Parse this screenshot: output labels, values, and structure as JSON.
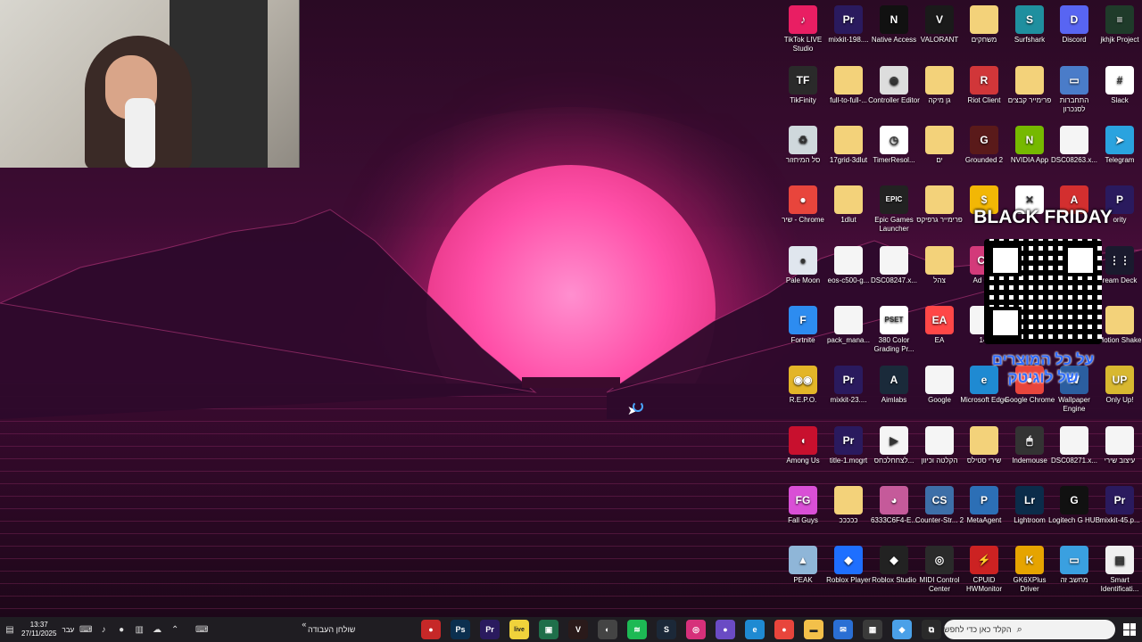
{
  "desktop_icons": [
    {
      "label": "TikTok LIVE Studio",
      "icon": "tiktok-icon",
      "color": "#e91e63",
      "glyph": "♪"
    },
    {
      "label": "mixkit-198....",
      "icon": "premiere-icon",
      "color": "#2a1a5e",
      "glyph": "Pr"
    },
    {
      "label": "Native Access",
      "icon": "native-access-icon",
      "color": "#111111",
      "glyph": "N"
    },
    {
      "label": "VALORANT",
      "icon": "valorant-icon",
      "color": "#1a1a1a",
      "glyph": "V"
    },
    {
      "label": "משחקים",
      "icon": "folder-icon",
      "color": "#f3d27a",
      "glyph": ""
    },
    {
      "label": "Surfshark",
      "icon": "surfshark-icon",
      "color": "#1f8f9f",
      "glyph": "S"
    },
    {
      "label": "Discord",
      "icon": "discord-icon",
      "color": "#5865f2",
      "glyph": "D"
    },
    {
      "label": "jkhjk Project",
      "icon": "project-icon",
      "color": "#1f3b2a",
      "glyph": "≡"
    },
    {
      "label": "TikFinity",
      "icon": "tikfinity-icon",
      "color": "#2a2a2a",
      "glyph": "TF"
    },
    {
      "label": "full-to-full-...",
      "icon": "folder-icon",
      "color": "#f3d27a",
      "glyph": ""
    },
    {
      "label": "Controller Editor",
      "icon": "controller-icon",
      "color": "#dddddd",
      "glyph": "◉"
    },
    {
      "label": "גן מיקה",
      "icon": "folder-icon",
      "color": "#f3d27a",
      "glyph": ""
    },
    {
      "label": "Riot Client",
      "icon": "riot-icon",
      "color": "#d13639",
      "glyph": "R"
    },
    {
      "label": "פרימייר קבצים",
      "icon": "folder-icon",
      "color": "#f3d27a",
      "glyph": ""
    },
    {
      "label": "התחברות לסנכרון",
      "icon": "pc-icon",
      "color": "#4a7cc9",
      "glyph": "▭"
    },
    {
      "label": "Slack",
      "icon": "slack-icon",
      "color": "#ffffff",
      "glyph": "#"
    },
    {
      "label": "סל המיחזור",
      "icon": "recycle-bin-icon",
      "color": "#cfd8dc",
      "glyph": "♻"
    },
    {
      "label": "17grid-3dlut",
      "icon": "folder-icon",
      "color": "#f3d27a",
      "glyph": ""
    },
    {
      "label": "TimerResol...",
      "icon": "timer-icon",
      "color": "#ffffff",
      "glyph": "◷"
    },
    {
      "label": "ים",
      "icon": "folder-icon",
      "color": "#f3d27a",
      "glyph": ""
    },
    {
      "label": "Grounded 2",
      "icon": "grounded-icon",
      "color": "#5a1a1a",
      "glyph": "G"
    },
    {
      "label": "NVIDIA App",
      "icon": "nvidia-icon",
      "color": "#76b900",
      "glyph": "N"
    },
    {
      "label": "DSC08263.x...",
      "icon": "file-icon",
      "color": "#f5f5f5",
      "glyph": ""
    },
    {
      "label": "Telegram",
      "icon": "telegram-icon",
      "color": "#2aa3df",
      "glyph": "➤"
    },
    {
      "label": "שיר - Chrome",
      "icon": "chrome-icon",
      "color": "#e8453c",
      "glyph": "●"
    },
    {
      "label": "1dlut",
      "icon": "folder-icon",
      "color": "#f3d27a",
      "glyph": ""
    },
    {
      "label": "Epic Games Launcher",
      "icon": "epic-games-icon",
      "color": "#222222",
      "glyph": "EPIC"
    },
    {
      "label": "פרימייר גרפיקס",
      "icon": "folder-icon",
      "color": "#f3d27a",
      "glyph": ""
    },
    {
      "label": "",
      "icon": "coin-icon",
      "color": "#f2b705",
      "glyph": "$"
    },
    {
      "label": "",
      "icon": "capcut-icon",
      "color": "#ffffff",
      "glyph": "✕"
    },
    {
      "label": "",
      "icon": "acrobat-icon",
      "color": "#d32f2f",
      "glyph": "A"
    },
    {
      "label": "ority",
      "icon": "premiere-icon",
      "color": "#2a1a5e",
      "glyph": "P"
    },
    {
      "label": "Pale Moon",
      "icon": "pale-moon-icon",
      "color": "#e0e6ee",
      "glyph": "●"
    },
    {
      "label": "eos-c500-g...",
      "icon": "file-icon",
      "color": "#f5f5f5",
      "glyph": ""
    },
    {
      "label": "DSC08247.x...",
      "icon": "file-icon",
      "color": "#f5f5f5",
      "glyph": ""
    },
    {
      "label": "צהל",
      "icon": "folder-icon",
      "color": "#f3d27a",
      "glyph": ""
    },
    {
      "label": "Ad Cre",
      "icon": "adobe-cc-icon",
      "color": "#d33a7a",
      "glyph": "Cc"
    },
    {
      "label": "ream Deck",
      "icon": "stream-deck-icon",
      "color": "#1a1a2e",
      "glyph": "⋮⋮"
    },
    {
      "label": "Fortnite",
      "icon": "fortnite-icon",
      "color": "#2d8cf0",
      "glyph": "F"
    },
    {
      "label": "pack_mana...",
      "icon": "file-icon",
      "color": "#f5f5f5",
      "glyph": ""
    },
    {
      "label": "380 Color Grading Pr...",
      "icon": "pset-icon",
      "color": "#ffffff",
      "glyph": "PSET"
    },
    {
      "label": "EA",
      "icon": "ea-icon",
      "color": "#ff4747",
      "glyph": "EA"
    },
    {
      "label": "14.",
      "icon": "file-icon",
      "color": "#f5f5f5",
      "glyph": ""
    },
    {
      "label": "Motion Shake",
      "icon": "folder-icon",
      "color": "#f3d27a",
      "glyph": ""
    },
    {
      "label": "R.E.P.O.",
      "icon": "repo-icon",
      "color": "#e3b528",
      "glyph": "◉◉"
    },
    {
      "label": "mixkit-23....",
      "icon": "premiere-icon",
      "color": "#2a1a5e",
      "glyph": "Pr"
    },
    {
      "label": "Aimlabs",
      "icon": "aimlabs-icon",
      "color": "#1a2a3a",
      "glyph": "A"
    },
    {
      "label": "Google",
      "icon": "file-icon",
      "color": "#f5f5f5",
      "glyph": ""
    },
    {
      "label": "Microsoft Edge",
      "icon": "edge-icon",
      "color": "#1f8ad2",
      "glyph": "e"
    },
    {
      "label": "Google Chrome",
      "icon": "chrome-icon",
      "color": "#e8453c",
      "glyph": "●"
    },
    {
      "label": "Wallpaper Engine",
      "icon": "wallpaper-engine-icon",
      "color": "#2b5ea0",
      "glyph": "W"
    },
    {
      "label": "Only Up!",
      "icon": "only-up-icon",
      "color": "#d8b830",
      "glyph": "UP"
    },
    {
      "label": "Among Us",
      "icon": "among-us-icon",
      "color": "#c8102e",
      "glyph": "◖"
    },
    {
      "label": "title-1.mogrt",
      "icon": "premiere-icon",
      "color": "#2a1a5e",
      "glyph": "Pr"
    },
    {
      "label": "לצחחלכחס...",
      "icon": "video-file-icon",
      "color": "#f5f5f5",
      "glyph": "▶"
    },
    {
      "label": "הקלטה וכיוון",
      "icon": "file-icon",
      "color": "#f5f5f5",
      "glyph": ""
    },
    {
      "label": "שירי סטילס",
      "icon": "folder-icon",
      "color": "#f3d27a",
      "glyph": ""
    },
    {
      "label": "Indemouse",
      "icon": "indemouse-icon",
      "color": "#333333",
      "glyph": "🖱"
    },
    {
      "label": "DSC08271.x...",
      "icon": "file-icon",
      "color": "#f5f5f5",
      "glyph": ""
    },
    {
      "label": "עיצוב שירי",
      "icon": "file-icon",
      "color": "#f5f5f5",
      "glyph": ""
    },
    {
      "label": "Fall Guys",
      "icon": "fall-guys-icon",
      "color": "#d94fd6",
      "glyph": "FG"
    },
    {
      "label": "כככככ",
      "icon": "folder-icon",
      "color": "#f3d27a",
      "glyph": ""
    },
    {
      "label": "6333C6F4-E...",
      "icon": "image-icon",
      "color": "#c55a9a",
      "glyph": "◕"
    },
    {
      "label": "Counter-Str... 2",
      "icon": "counter-strike-icon",
      "color": "#3d6fa8",
      "glyph": "CS"
    },
    {
      "label": "MetaAgent",
      "icon": "metaagent-icon",
      "color": "#2c6fb6",
      "glyph": "P"
    },
    {
      "label": "Lightroom",
      "icon": "lightroom-icon",
      "color": "#0b2c4a",
      "glyph": "Lr"
    },
    {
      "label": "Logitech G HUB",
      "icon": "logitech-icon",
      "color": "#111111",
      "glyph": "G"
    },
    {
      "label": "mixkit-45.p...",
      "icon": "premiere-proj-icon",
      "color": "#2a1a5e",
      "glyph": "Pr"
    },
    {
      "label": "PEAK",
      "icon": "peak-icon",
      "color": "#8fb6d8",
      "glyph": "▲"
    },
    {
      "label": "Roblox Player",
      "icon": "roblox-icon",
      "color": "#1e6fff",
      "glyph": "◆"
    },
    {
      "label": "Roblox Studio",
      "icon": "roblox-studio-icon",
      "color": "#222222",
      "glyph": "◆"
    },
    {
      "label": "MIDI Control Center",
      "icon": "midi-icon",
      "color": "#2a2a2a",
      "glyph": "◎"
    },
    {
      "label": "CPUID HWMonitor",
      "icon": "hwmonitor-icon",
      "color": "#cc2222",
      "glyph": "⚡"
    },
    {
      "label": "GK6XPlus Driver",
      "icon": "gk6x-icon",
      "color": "#e6a400",
      "glyph": "K"
    },
    {
      "label": "מחשב זה",
      "icon": "this-pc-icon",
      "color": "#3aa0e0",
      "glyph": "▭"
    },
    {
      "label": "Smart Identificati...",
      "icon": "smart-id-icon",
      "color": "#f0f0f0",
      "glyph": "▤"
    }
  ],
  "promo": {
    "title": "BLACK FRIDAY",
    "hebrew_line1": "על כל המוצרים",
    "hebrew_line2": "של לוגיטק"
  },
  "taskbar": {
    "time": "13:37",
    "date": "27/11/2025",
    "language": "עבר",
    "workspace_label": "שולחן העבודה",
    "workspace_chevron": "«",
    "search_placeholder": "הקלד כאן כדי לחפש",
    "apps": [
      {
        "name": "record-app",
        "color": "#c62828",
        "glyph": "●"
      },
      {
        "name": "photoshop-app",
        "color": "#0b2f4f",
        "glyph": "Ps"
      },
      {
        "name": "premiere-app",
        "color": "#2a1a5e",
        "glyph": "Pr"
      },
      {
        "name": "live-app",
        "color": "#f0d23b",
        "glyph": "live"
      },
      {
        "name": "green-app",
        "color": "#1f6f4a",
        "glyph": "▣"
      },
      {
        "name": "valorant-app",
        "color": "#2a1a1a",
        "glyph": "V"
      },
      {
        "name": "browser-app",
        "color": "#444444",
        "glyph": "◐"
      },
      {
        "name": "spotify-app",
        "color": "#1db954",
        "glyph": "≋"
      },
      {
        "name": "steam-app",
        "color": "#1b2838",
        "glyph": "S"
      },
      {
        "name": "instagram-app",
        "color": "#d6307a",
        "glyph": "◎"
      },
      {
        "name": "chrome-profile-app",
        "color": "#6a4bc4",
        "glyph": "●"
      },
      {
        "name": "edge-app",
        "color": "#1f8ad2",
        "glyph": "e"
      },
      {
        "name": "chrome-app",
        "color": "#e8453c",
        "glyph": "●"
      },
      {
        "name": "file-explorer-app",
        "color": "#f3c04a",
        "glyph": "▬"
      },
      {
        "name": "mail-app",
        "color": "#2a6fd4",
        "glyph": "✉"
      },
      {
        "name": "store-app",
        "color": "#3a3a3a",
        "glyph": "▦"
      },
      {
        "name": "copilot-app",
        "color": "#4aa0e8",
        "glyph": "◆"
      },
      {
        "name": "task-view-app",
        "color": "#2a2a2a",
        "glyph": "⧉"
      }
    ]
  }
}
